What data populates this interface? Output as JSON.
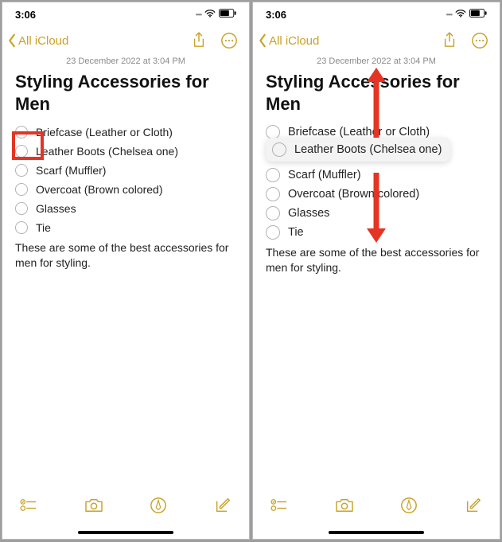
{
  "status": {
    "time": "3:06",
    "signal": "••••",
    "battery_icon": "battery-icon"
  },
  "nav": {
    "back_label": "All iCloud"
  },
  "timestamp": "23 December 2022 at 3:04 PM",
  "title": "Styling Accessories for Men",
  "items": [
    "Briefcase (Leather or Cloth)",
    "Leather Boots (Chelsea one)",
    "Scarf (Muffler)",
    "Overcoat (Brown colored)",
    "Glasses",
    "Tie"
  ],
  "paragraph": "These are some of the best accessories for men for styling.",
  "accent": "#c9a227",
  "highlight_index_left": 1,
  "drag_index_right": 1
}
